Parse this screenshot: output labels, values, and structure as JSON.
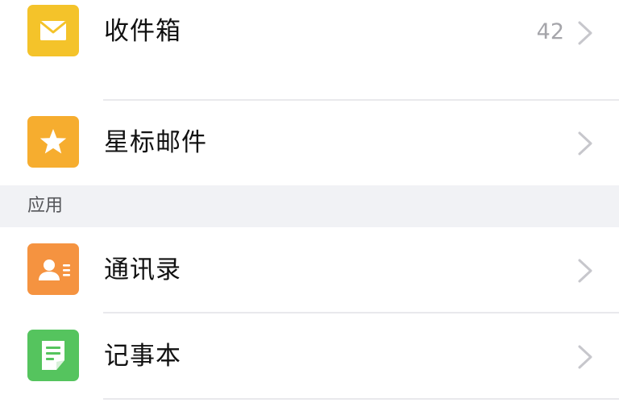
{
  "mail_folders": {
    "items": [
      {
        "label": "收件箱",
        "badge": "42",
        "icon": "inbox-envelope-icon",
        "icon_color": "#f4c32a"
      },
      {
        "label": "星标邮件",
        "badge": "",
        "icon": "star-icon",
        "icon_color": "#f6ad2f"
      }
    ]
  },
  "apps_section": {
    "title": "应用",
    "items": [
      {
        "label": "通讯录",
        "icon": "contacts-card-icon",
        "icon_color": "#f59340"
      },
      {
        "label": "记事本",
        "icon": "notepad-icon",
        "icon_color": "#55c45e"
      }
    ]
  },
  "colors": {
    "section_background": "#f1f2f5",
    "divider": "#e9e9ec",
    "chevron": "#c7c7cc",
    "badge_text": "#a5a5aa"
  }
}
